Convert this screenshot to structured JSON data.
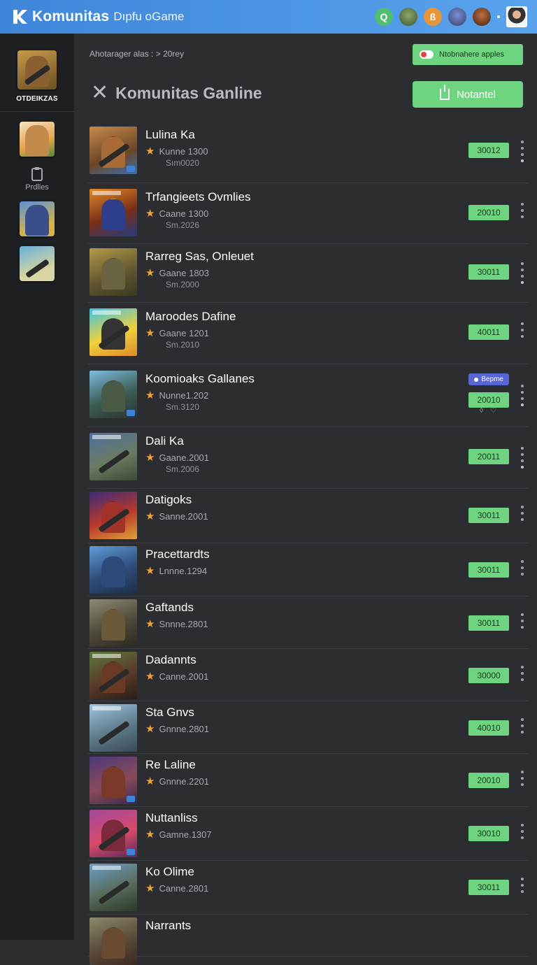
{
  "header": {
    "brand_name": "Komunitas",
    "brand_sub": "Dıpfu oGame",
    "top_icons": [
      {
        "name": "search-icon",
        "glyph": "Q",
        "color": "#4fbe6e"
      },
      {
        "name": "soldier-avatar-icon",
        "color": "#6f8a52"
      },
      {
        "name": "notification-icon",
        "glyph": "ß",
        "color": "#e8953a"
      },
      {
        "name": "game-avatar-icon",
        "color": "#5a66a8"
      },
      {
        "name": "player-avatar-icon",
        "color": "#8a4a24"
      }
    ]
  },
  "sidebar": {
    "title": "OTDEIKZAS",
    "profile_label": "Prdlles"
  },
  "main": {
    "breadcrumb": "Ahotarager alas  :  >  20rey",
    "notif_button": "Ntobnahere apples",
    "page_title": "Komunitas Ganline",
    "primary_button": "Notantel"
  },
  "games": [
    {
      "name": "Lulina Ka",
      "meta": "Kunne 1300",
      "sub": "Sım0020",
      "count": "30012"
    },
    {
      "name": "Trfangieets Ovmlies",
      "meta": "Caane 1300",
      "sub": "Sm.2026",
      "count": "20010"
    },
    {
      "name": "Rarreg Sas, Onleuet",
      "meta": "Gaane 1803",
      "sub": "Sm.2000",
      "count": "30011"
    },
    {
      "name": "Maroodes Dafine",
      "meta": "Gaane 1201",
      "sub": "Sm.2010",
      "count": "40011"
    },
    {
      "name": "Koomioaks Gallanes",
      "meta": "Nunne1.202",
      "sub": "Sm.3120",
      "count": "20010",
      "tag": "Bepme"
    },
    {
      "name": "Dali Ka",
      "meta": "Gaane.2001",
      "sub": "Sm.2006",
      "count": "20011"
    },
    {
      "name": "Datigoks",
      "meta": "Sanne.2001",
      "sub": "",
      "count": "30011"
    },
    {
      "name": "Pracettardts",
      "meta": "Lnnne.1294",
      "sub": "",
      "count": "30011"
    },
    {
      "name": "Gaftands",
      "meta": "Snnne.2801",
      "sub": "",
      "count": "30011"
    },
    {
      "name": "Dadannts",
      "meta": "Canne.2001",
      "sub": "",
      "count": "30000"
    },
    {
      "name": "Sta Gnvs",
      "meta": "Gnnne.2801",
      "sub": "",
      "count": "40010"
    },
    {
      "name": "Re Laline",
      "meta": "Gnnne.2201",
      "sub": "",
      "count": "20010"
    },
    {
      "name": "Nuttanliss",
      "meta": "Gamne.1307",
      "sub": "",
      "count": "30010"
    },
    {
      "name": "Ko Olime",
      "meta": "Canne.2801",
      "sub": "",
      "count": "30011"
    },
    {
      "name": "Narrants",
      "meta": "",
      "sub": "",
      "count": ""
    }
  ],
  "colors": {
    "topbar": "#4d97e6",
    "accent_green": "#6ed47f",
    "sidebar_bg": "#1e1f22",
    "main_bg": "#2b2d31",
    "tag_purple": "#5865d6"
  }
}
